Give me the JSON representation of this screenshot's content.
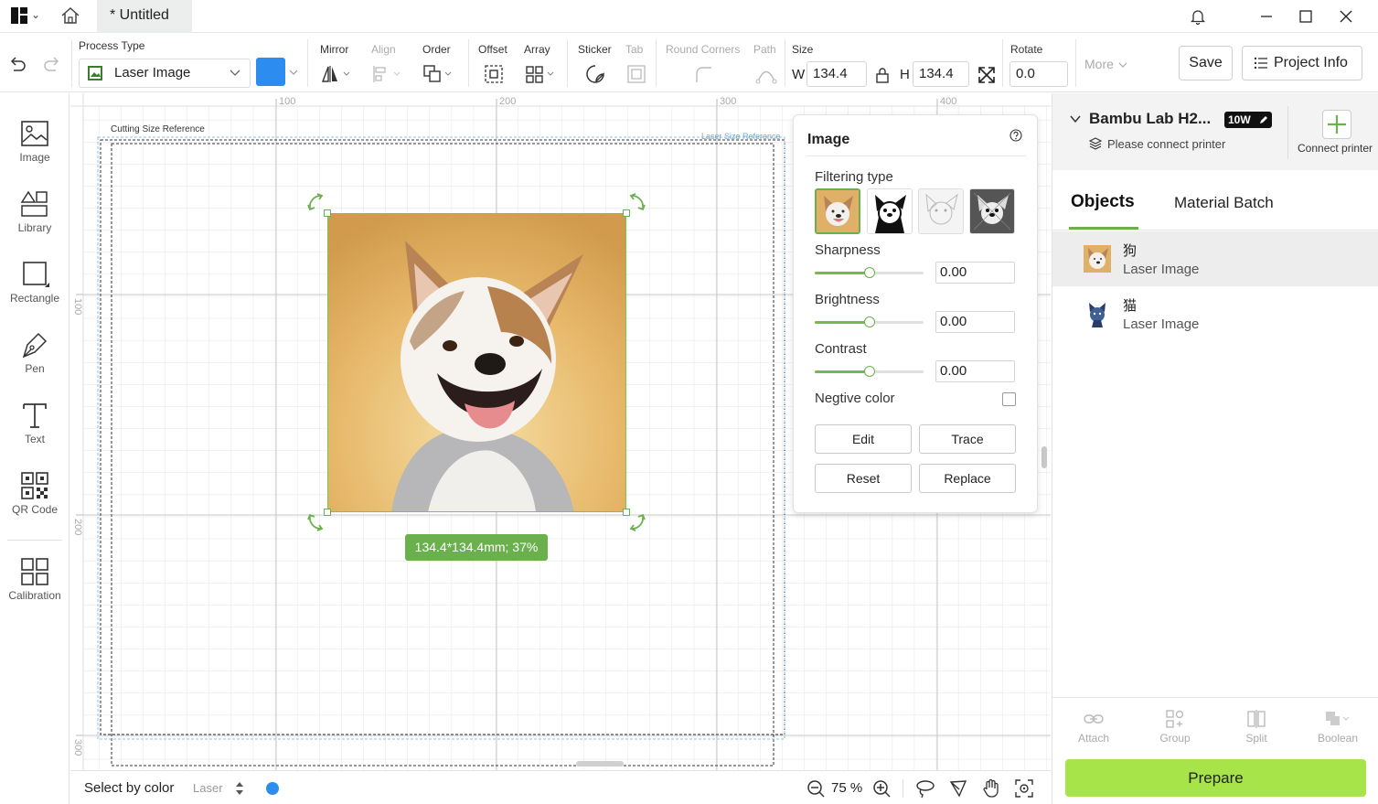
{
  "window": {
    "doc_title": "* Untitled"
  },
  "toolbar": {
    "process_type_label": "Process Type",
    "process_type_value": "Laser Image",
    "accent_color": "#2d8cf0",
    "mirror": "Mirror",
    "align": "Align",
    "order": "Order",
    "offset": "Offset",
    "array": "Array",
    "sticker": "Sticker",
    "tab": "Tab",
    "round_corners": "Round Corners",
    "path": "Path",
    "size_label": "Size",
    "w_label": "W",
    "w_value": "134.4",
    "h_label": "H",
    "h_value": "134.4",
    "rotate_label": "Rotate",
    "rotate_value": "0.0",
    "more": "More",
    "save": "Save",
    "project_info": "Project Info"
  },
  "leftbar": {
    "image": "Image",
    "library": "Library",
    "rectangle": "Rectangle",
    "pen": "Pen",
    "text": "Text",
    "qr_code": "QR Code",
    "calibration": "Calibration"
  },
  "canvas": {
    "ruler_top": [
      "100",
      "200",
      "300",
      "400"
    ],
    "ruler_left": [
      "100",
      "200",
      "300"
    ],
    "cutting_ref": "Cutting Size Reference",
    "laser_ref": "Laser Size Reference",
    "size_badge": "134.4*134.4mm; 37%"
  },
  "statusbar": {
    "select_by_color": "Select by color",
    "laser": "Laser",
    "zoom": "75 %",
    "dot_color": "#2d8cf0"
  },
  "image_panel": {
    "title": "Image",
    "filtering_type": "Filtering type",
    "sharpness": "Sharpness",
    "sharpness_value": "0.00",
    "brightness": "Brightness",
    "brightness_value": "0.00",
    "contrast": "Contrast",
    "contrast_value": "0.00",
    "negtive_color": "Negtive color",
    "edit": "Edit",
    "trace": "Trace",
    "reset": "Reset",
    "replace": "Replace"
  },
  "right_panel": {
    "printer_name": "Bambu Lab H2...",
    "power_badge": "10W",
    "connect_status": "Please connect printer",
    "connect_printer": "Connect printer",
    "tabs": {
      "objects": "Objects",
      "material_batch": "Material Batch"
    },
    "objects": [
      {
        "name": "狗",
        "type": "Laser Image"
      },
      {
        "name": "猫",
        "type": "Laser Image"
      }
    ],
    "tools": {
      "attach": "Attach",
      "group": "Group",
      "split": "Split",
      "boolean": "Boolean"
    },
    "prepare": "Prepare"
  }
}
